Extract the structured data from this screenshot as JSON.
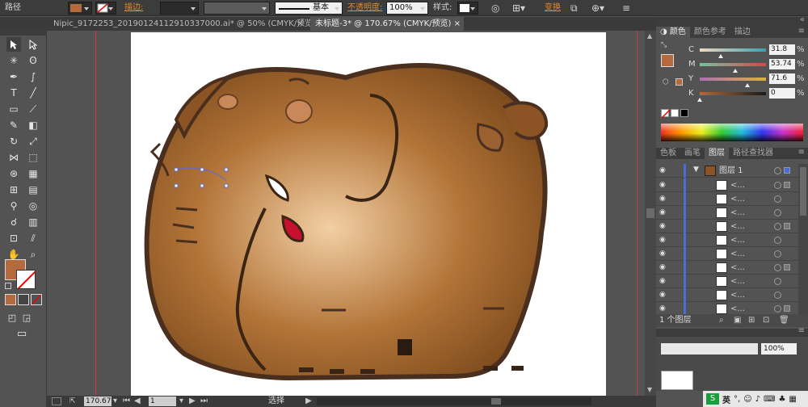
{
  "control_bar": {
    "selection_label": "路径",
    "stroke_label": "描边:",
    "stroke_profile": "基本",
    "opacity_label": "不透明度:",
    "opacity_value": "100%",
    "style_label": "样式:",
    "transform_label": "变换",
    "fill_color": "#b46a3c"
  },
  "doc_tabs": [
    {
      "label": "Nipic_9172253_20190124112910337000.ai* @ 50% (CMYK/预览)",
      "active": false
    },
    {
      "label": "未标题-3* @ 170.67% (CMYK/预览)",
      "active": true
    }
  ],
  "status_bar": {
    "zoom": "170.67",
    "page": "1",
    "tool_status": "选择"
  },
  "color_panel": {
    "tabs": [
      "颜色",
      "颜色参考",
      "描边"
    ],
    "active_tab": "颜色",
    "sliders": [
      {
        "channel": "C",
        "value": "31.8",
        "fraction": 0.318
      },
      {
        "channel": "M",
        "value": "53.74",
        "fraction": 0.537
      },
      {
        "channel": "Y",
        "value": "71.6",
        "fraction": 0.716
      },
      {
        "channel": "K",
        "value": "0",
        "fraction": 0
      }
    ],
    "unit": "%",
    "swatch_color": "#b46a3c"
  },
  "layers_panel": {
    "tabs": [
      "色板",
      "画笔",
      "图层",
      "路径查找器"
    ],
    "active_tab": "图层",
    "top_layer": {
      "name": "图层 1"
    },
    "sublayers": [
      "<...",
      "<...",
      "<...",
      "<...",
      "<...",
      "<...",
      "<...",
      "<...",
      "<...",
      "<...",
      "<..."
    ],
    "footer_label": "1 个图层"
  },
  "lower_panel": {
    "opacity_value": "100%"
  },
  "taskbar": {
    "ime_label": "英"
  },
  "colors": {
    "ui_dark": "#3c3c3c",
    "ui_mid": "#535353",
    "elephant_body": "#a0602c",
    "elephant_outline": "#4a2e1e",
    "guide": "#c83c3c",
    "accent_orange": "#e08a2c"
  }
}
